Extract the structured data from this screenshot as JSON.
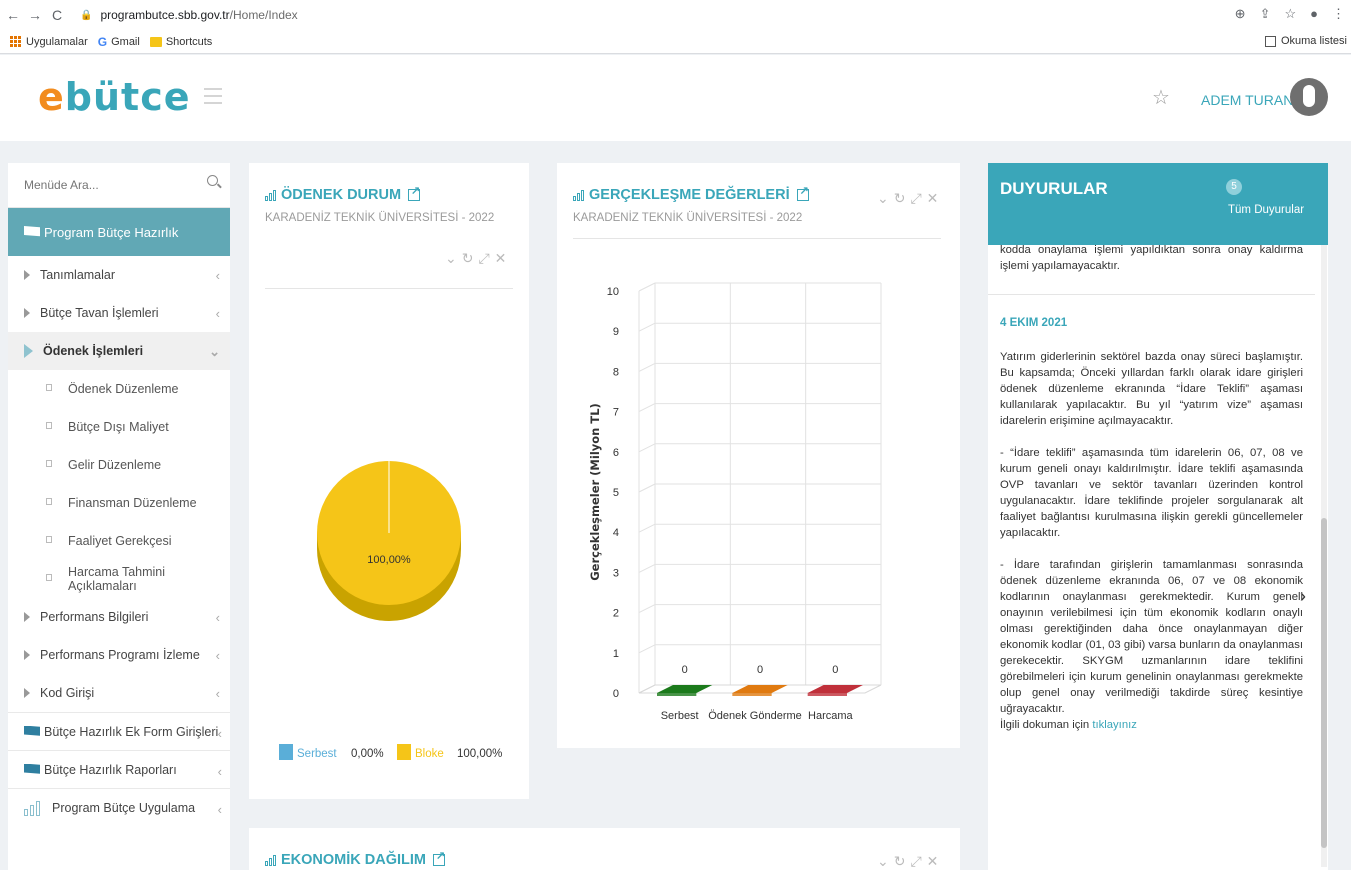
{
  "browser": {
    "url_host": "programbutce.sbb.gov.tr",
    "url_path": "/Home/Index",
    "bookmarks": [
      "Uygulamalar",
      "Gmail",
      "Shortcuts"
    ],
    "reading_list": "Okuma listesi"
  },
  "header": {
    "logo_e": "e",
    "logo_rest": "bütce",
    "user_name": "ADEM TURAN"
  },
  "sidebar": {
    "search_placeholder": "Menüde Ara...",
    "section_title": "Program Bütçe Hazırlık",
    "items": [
      "Tanımlamalar",
      "Bütçe Tavan İşlemleri",
      "Ödenek İşlemleri"
    ],
    "sub_items": [
      "Ödenek Düzenleme",
      "Bütçe Dışı Maliyet",
      "Gelir Düzenleme",
      "Finansman Düzenleme",
      "Faaliyet Gerekçesi",
      "Harcama Tahmini Açıklamaları"
    ],
    "items_after": [
      "Performans Bilgileri",
      "Performans Programı İzleme",
      "Kod Girişi"
    ],
    "sections": [
      "Bütçe Hazırlık Ek Form Girişleri",
      "Bütçe Hazırlık Raporları",
      "Program Bütçe Uygulama"
    ]
  },
  "panel_odenek": {
    "title": "ÖDENEK DURUM",
    "subtitle": "KARADENİZ TEKNİK ÜNİVERSİTESİ - 2022",
    "pie_label": "100,00%",
    "legend": [
      {
        "name": "Serbest",
        "value": "0,00%",
        "color": "#5aaed8"
      },
      {
        "name": "Bloke",
        "value": "100,00%",
        "color": "#f5c518"
      }
    ]
  },
  "panel_gerceklesme": {
    "title": "GERÇEKLEŞME DEĞERLERİ",
    "subtitle": "KARADENİZ TEKNİK ÜNİVERSİTESİ - 2022"
  },
  "panel_ekonomik": {
    "title": "EKONOMİK DAĞILIM"
  },
  "chart_data": [
    {
      "type": "pie",
      "categories": [
        "Serbest",
        "Bloke"
      ],
      "values": [
        0,
        100
      ],
      "colors": [
        "#5aaed8",
        "#f5c518"
      ],
      "data_labels": [
        "100,00%"
      ]
    },
    {
      "type": "bar",
      "categories": [
        "Serbest",
        "Ödenek Gönderme",
        "Harcama"
      ],
      "values": [
        0,
        0,
        0
      ],
      "data_labels": [
        "0",
        "0",
        "0"
      ],
      "colors": [
        "#1b7a1b",
        "#e07a10",
        "#c0303a"
      ],
      "ylabel": "Gerçekleşmeler (Milyon TL)",
      "ylim": [
        0,
        10
      ],
      "yticks": [
        "0",
        "1",
        "2",
        "3",
        "4",
        "5",
        "6",
        "7",
        "8",
        "9",
        "10"
      ],
      "grid": true
    }
  ],
  "announcements": {
    "title": "DUYURULAR",
    "count": "5",
    "all_link": "Tüm Duyurular",
    "prev_text": "kodda onaylama işlemi yapıldıktan sonra onay kaldırma işlemi yapılamayacaktır.",
    "date": "4 EKIM 2021",
    "p1": "Yatırım giderlerinin sektörel bazda onay süreci başlamıştır. Bu kapsamda; Önceki yıllardan farklı olarak idare girişleri ödenek düzenleme ekranında “İdare Teklifi” aşaması kullanılarak yapılacaktır. Bu yıl “yatırım vize” aşaması idarelerin erişimine açılmayacaktır.",
    "p2": "- “İdare teklifi” aşamasında tüm idarelerin 06, 07, 08 ve kurum geneli onayı kaldırılmıştır. İdare teklifi aşamasında OVP tavanları ve sektör tavanları üzerinden kontrol uygulanacaktır. İdare teklifinde projeler sorgulanarak alt faaliyet bağlantısı kurulmasına ilişkin gerekli güncellemeler yapılacaktır.",
    "p3": "- İdare tarafından girişlerin tamamlanması sonrasında ödenek düzenleme ekranında 06, 07 ve 08 ekonomik kodlarının onaylanması gerekmektedir. Kurum geneli onayının verilebilmesi için tüm ekonomik kodların onaylı olması gerektiğinden daha önce onaylanmayan diğer ekonomik kodlar (01, 03 gibi) varsa bunların da onaylanması gerekecektir. SKYGM uzmanlarının idare teklifini görebilmeleri için kurum genelinin onaylanması gerekmekte olup genel onay verilmediği takdirde süreç kesintiye uğrayacaktır.",
    "doc_prefix": "İlgili dokuman için",
    "doc_link": "tıklayınız"
  }
}
